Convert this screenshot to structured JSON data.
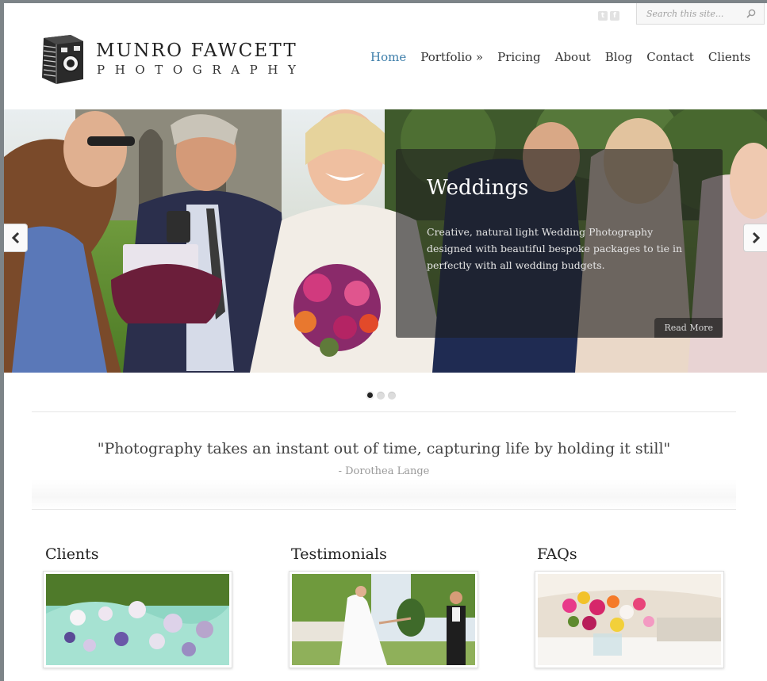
{
  "site": {
    "brand_name": "MUNRO FAWCETT",
    "brand_sub": "PHOTOGRAPHY"
  },
  "header": {
    "social": [
      "t",
      "f"
    ],
    "search_placeholder": "Search this site...",
    "nav": [
      {
        "label": "Home",
        "active": true
      },
      {
        "label": "Portfolio »",
        "active": false
      },
      {
        "label": "Pricing",
        "active": false
      },
      {
        "label": "About",
        "active": false
      },
      {
        "label": "Blog",
        "active": false
      },
      {
        "label": "Contact",
        "active": false
      },
      {
        "label": "Clients",
        "active": false
      }
    ]
  },
  "slider": {
    "title": "Weddings",
    "text": "Creative, natural light Wedding Photography designed with beautiful bespoke packages to tie in perfectly with all wedding budgets.",
    "read_more": "Read More",
    "active_dot": 1,
    "dot_count": 3
  },
  "quote": {
    "text": "\"Photography takes an instant out of time, capturing life by holding it still\"",
    "author": "- Dorothea Lange"
  },
  "columns": [
    {
      "title": "Clients"
    },
    {
      "title": "Testimonials"
    },
    {
      "title": "FAQs"
    }
  ],
  "colors": {
    "accent": "#3d7eaa",
    "text": "#333333",
    "background": "#ffffff"
  }
}
